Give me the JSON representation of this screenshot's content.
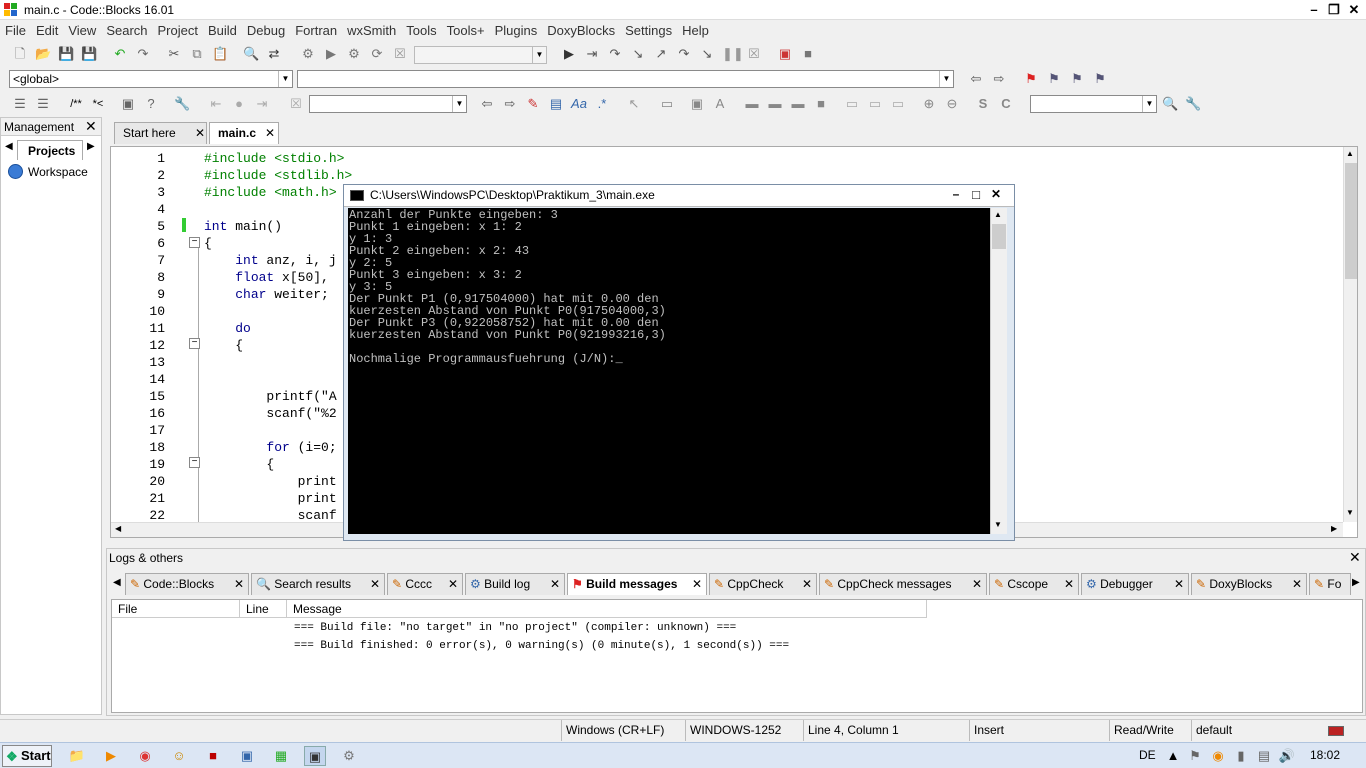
{
  "window": {
    "title": "main.c - Code::Blocks 16.01"
  },
  "menus": [
    "File",
    "Edit",
    "View",
    "Search",
    "Project",
    "Build",
    "Debug",
    "Fortran",
    "wxSmith",
    "Tools",
    "Tools+",
    "Plugins",
    "DoxyBlocks",
    "Settings",
    "Help"
  ],
  "toolbar": {
    "scope_combo": "<global>",
    "symbol_combo": ""
  },
  "management": {
    "title": "Management",
    "tab": "Projects",
    "workspace": "Workspace"
  },
  "editor_tabs": [
    {
      "label": "Start here"
    },
    {
      "label": "main.c"
    }
  ],
  "editor": {
    "lines": [
      {
        "n": "1",
        "code": "#include <stdio.h>"
      },
      {
        "n": "2",
        "code": "#include <stdlib.h>"
      },
      {
        "n": "3",
        "code": "#include <math.h>"
      },
      {
        "n": "4",
        "code": ""
      },
      {
        "n": "5",
        "code": "int main()"
      },
      {
        "n": "6",
        "code": "{"
      },
      {
        "n": "7",
        "code": "    int anz, i, j"
      },
      {
        "n": "8",
        "code": "    float x[50],"
      },
      {
        "n": "9",
        "code": "    char weiter;"
      },
      {
        "n": "10",
        "code": ""
      },
      {
        "n": "11",
        "code": "    do"
      },
      {
        "n": "12",
        "code": "    {"
      },
      {
        "n": "13",
        "code": ""
      },
      {
        "n": "14",
        "code": ""
      },
      {
        "n": "15",
        "code": "        printf(\"A"
      },
      {
        "n": "16",
        "code": "        scanf(\"%2"
      },
      {
        "n": "17",
        "code": ""
      },
      {
        "n": "18",
        "code": "        for (i=0;"
      },
      {
        "n": "19",
        "code": "        {"
      },
      {
        "n": "20",
        "code": "            print"
      },
      {
        "n": "21",
        "code": "            print"
      },
      {
        "n": "22",
        "code": "            scanf"
      }
    ]
  },
  "console": {
    "title": "C:\\Users\\WindowsPC\\Desktop\\Praktikum_3\\main.exe",
    "output": "Anzahl der Punkte eingeben: 3\nPunkt 1 eingeben: x 1: 2\ny 1: 3\nPunkt 2 eingeben: x 2: 43\ny 2: 5\nPunkt 3 eingeben: x 3: 2\ny 3: 5\nDer Punkt P1 (0,917504000) hat mit 0.00 den\nkuerzesten Abstand von Punkt P0(917504000,3)\nDer Punkt P3 (0,922058752) hat mit 0.00 den\nkuerzesten Abstand von Punkt P0(921993216,3)\n\nNochmalige Programmausfuehrung (J/N):_"
  },
  "logs": {
    "title": "Logs & others",
    "tabs": [
      {
        "label": "Code::Blocks"
      },
      {
        "label": "Search results"
      },
      {
        "label": "Cccc"
      },
      {
        "label": "Build log"
      },
      {
        "label": "Build messages"
      },
      {
        "label": "CppCheck"
      },
      {
        "label": "CppCheck messages"
      },
      {
        "label": "Cscope"
      },
      {
        "label": "Debugger"
      },
      {
        "label": "DoxyBlocks"
      },
      {
        "label": "Fo"
      }
    ],
    "columns": [
      "File",
      "Line",
      "Message"
    ],
    "messages": [
      "=== Build file: \"no target\" in \"no project\" (compiler: unknown) ===",
      "=== Build finished: 0 error(s), 0 warning(s) (0 minute(s), 1 second(s)) ==="
    ]
  },
  "status": {
    "eol": "Windows (CR+LF)",
    "encoding": "WINDOWS-1252",
    "position": "Line 4, Column 1",
    "mode": "Insert",
    "access": "Read/Write",
    "theme": "default"
  },
  "taskbar": {
    "start": "Start",
    "lang": "DE",
    "time": "18:02"
  },
  "colors": {
    "preprocessor": "#008000",
    "keyword": "#00008b",
    "console_bg": "#000000",
    "console_fg": "#c0c0c0"
  }
}
